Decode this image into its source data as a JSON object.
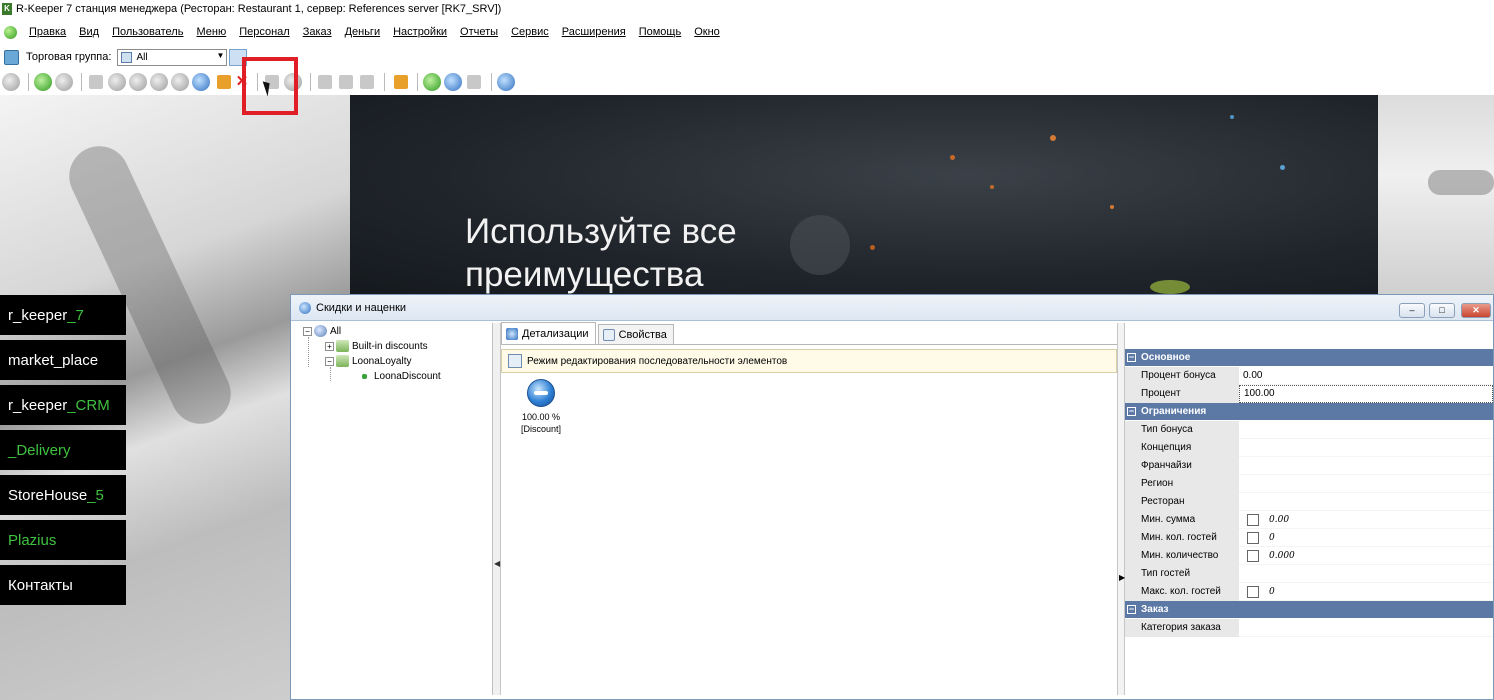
{
  "window_title": "R-Keeper 7 станция менеджера (Ресторан: Restaurant 1, сервер: References server [RK7_SRV])",
  "menu": [
    "Правка",
    "Вид",
    "Пользователь",
    "Меню",
    "Персонал",
    "Заказ",
    "Деньги",
    "Настройки",
    "Отчеты",
    "Сервис",
    "Расширения",
    "Помощь",
    "Окно"
  ],
  "trade_group": {
    "label": "Торговая группа:",
    "value": "All"
  },
  "hero": {
    "title": "Используйте все преимущества"
  },
  "side_nav": [
    {
      "prefix": "r_keeper",
      "suffix": "_7"
    },
    {
      "prefix": "market_place",
      "suffix": ""
    },
    {
      "prefix": "r_keeper",
      "suffix": "_CRM"
    },
    {
      "prefix": "",
      "suffix": "_Delivery"
    },
    {
      "prefix": "StoreHouse",
      "suffix": "_5"
    },
    {
      "prefix": "",
      "suffix": "Plazius"
    },
    {
      "prefix": "Контакты",
      "suffix": ""
    }
  ],
  "dialog": {
    "title": "Скидки и наценки",
    "tree": {
      "root": "All",
      "children": [
        "Built-in discounts",
        "LoonaLoyalty"
      ],
      "leaf": "LoonaDiscount"
    },
    "tabs": [
      "Детализации",
      "Свойства"
    ],
    "mode_text": "Режим редактирования последовательности элементов",
    "item": {
      "value": "100.00 %",
      "type": "[Discount]"
    },
    "props": {
      "cat_main": "Основное",
      "bonus_percent_label": "Процент бонуса",
      "bonus_percent_value": "0.00",
      "percent_label": "Процент",
      "percent_value": "100.00",
      "cat_limits": "Ограничения",
      "bonus_type": "Тип бонуса",
      "concept": "Концепция",
      "franchise": "Франчайзи",
      "region": "Регион",
      "restaurant": "Ресторан",
      "min_sum_label": "Мин. сумма",
      "min_sum_value": "0.00",
      "min_guests_label": "Мин. кол. гостей",
      "min_guests_value": "0",
      "min_qty_label": "Мин. количество",
      "min_qty_value": "0.000",
      "guest_type": "Тип гостей",
      "max_guests_label": "Макс. кол. гостей",
      "max_guests_value": "0",
      "cat_order": "Заказ",
      "order_category": "Категория заказа"
    }
  }
}
